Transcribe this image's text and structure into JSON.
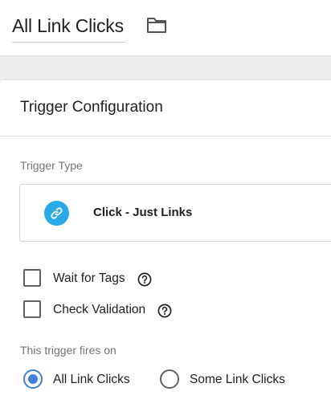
{
  "header": {
    "title": "All Link Clicks",
    "folder_icon": "folder-icon"
  },
  "panel": {
    "title": "Trigger Configuration",
    "trigger_type": {
      "label": "Trigger Type",
      "value": "Click - Just Links",
      "icon": "link-icon",
      "icon_color": "#29a9e6"
    },
    "options": [
      {
        "label": "Wait for Tags",
        "checked": false,
        "help_icon": "help-icon"
      },
      {
        "label": "Check Validation",
        "checked": false,
        "help_icon": "help-icon"
      }
    ],
    "fires_on": {
      "label": "This trigger fires on",
      "choices": [
        {
          "label": "All Link Clicks",
          "selected": true
        },
        {
          "label": "Some Link Clicks",
          "selected": false
        }
      ],
      "accent_color": "#3f7fd5"
    }
  }
}
